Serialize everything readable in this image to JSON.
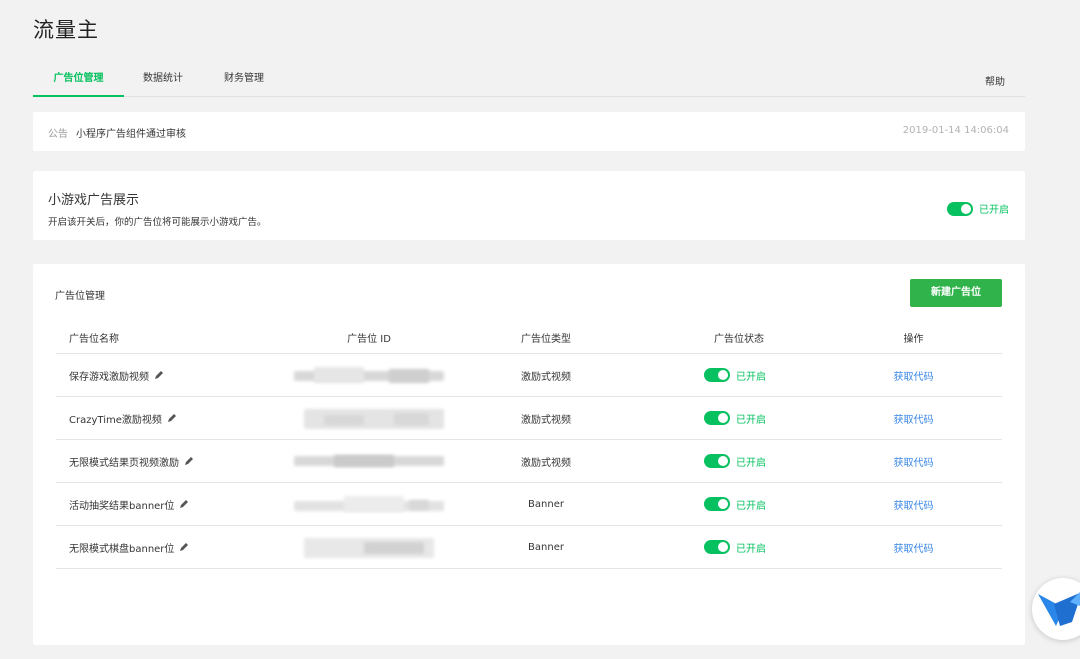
{
  "app": {
    "title": "流量主"
  },
  "tabs": [
    {
      "label": "广告位管理",
      "active": true
    },
    {
      "label": "数据统计",
      "active": false
    },
    {
      "label": "财务管理",
      "active": false
    }
  ],
  "help_label": "帮助",
  "notice": {
    "label": "公告",
    "text": "小程序广告组件通过审核",
    "time": "2019-01-14 14:06:04"
  },
  "minigame": {
    "title": "小游戏广告展示",
    "description": "开启该开关后，你的广告位将可能展示小游戏广告。",
    "toggle_label": "已开启",
    "enabled": true
  },
  "ad_manage": {
    "title": "广告位管理",
    "new_button": "新建广告位",
    "columns": [
      "广告位名称",
      "广告位 ID",
      "广告位类型",
      "广告位状态",
      "操作"
    ],
    "rows": [
      {
        "name": "保存游戏激励视频",
        "type": "激励式视频",
        "status": "已开启",
        "action": "获取代码"
      },
      {
        "name": "CrazyTime激励视频",
        "type": "激励式视频",
        "status": "已开启",
        "action": "获取代码"
      },
      {
        "name": "无限模式结果页视频激励",
        "type": "激励式视频",
        "status": "已开启",
        "action": "获取代码"
      },
      {
        "name": "活动抽奖结果banner位",
        "type": "Banner",
        "status": "已开启",
        "action": "获取代码"
      },
      {
        "name": "无限模式棋盘banner位",
        "type": "Banner",
        "status": "已开启",
        "action": "获取代码"
      }
    ]
  },
  "colors": {
    "accent": "#07c160",
    "link": "#3a87e4"
  },
  "icons": {
    "edit": "pencil-icon",
    "floating": "bird-logo-icon"
  }
}
